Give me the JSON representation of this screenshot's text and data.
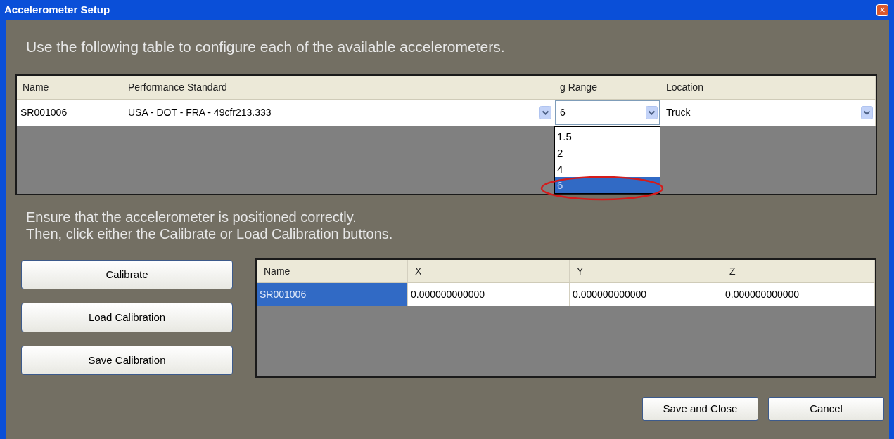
{
  "window": {
    "title": "Accelerometer Setup",
    "close": "×"
  },
  "instruction": "Use the following table to configure each of the available accelerometers.",
  "config_table": {
    "columns": [
      "Name",
      "Performance Standard",
      "g Range",
      "Location"
    ],
    "rows": [
      {
        "cells": [
          {
            "kind": "text",
            "value": "SR001006"
          },
          {
            "kind": "combo",
            "value": "USA - DOT - FRA - 49cfr213.333"
          },
          {
            "kind": "combo",
            "value": "6"
          },
          {
            "kind": "combo",
            "value": "Truck"
          }
        ]
      }
    ]
  },
  "g_range_dropdown": {
    "options": [
      {
        "label": "1.5",
        "selected": false
      },
      {
        "label": "2",
        "selected": false
      },
      {
        "label": "4",
        "selected": false
      },
      {
        "label": "6",
        "selected": true
      }
    ]
  },
  "position_note": [
    "Ensure that the accelerometer is positioned correctly.",
    "Then, click either the Calibrate or Load Calibration buttons."
  ],
  "action_buttons": [
    "Calibrate",
    "Load Calibration",
    "Save Calibration"
  ],
  "calibration_table": {
    "columns": [
      "Name",
      "X",
      "Y",
      "Z"
    ],
    "rows": [
      {
        "cells": [
          {
            "value": "SR001006",
            "selected": true
          },
          {
            "value": "0.000000000000",
            "selected": false
          },
          {
            "value": "0.000000000000",
            "selected": false
          },
          {
            "value": "0.000000000000",
            "selected": false
          }
        ]
      }
    ]
  },
  "dialog_buttons": [
    "Save and Close",
    "Cancel"
  ]
}
